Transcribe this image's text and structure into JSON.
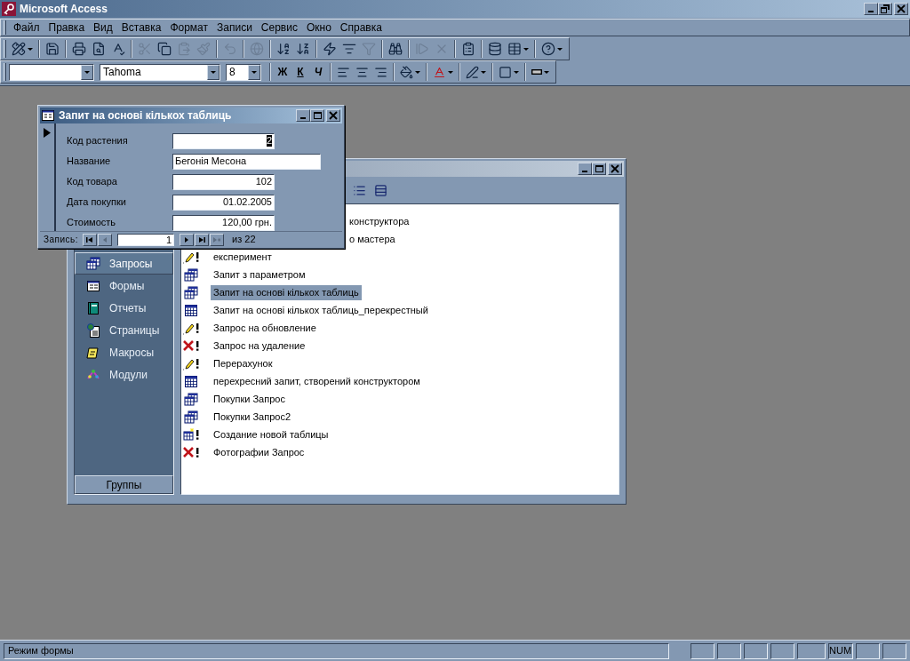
{
  "app": {
    "title": "Microsoft Access"
  },
  "menu": [
    "Файл",
    "Правка",
    "Вид",
    "Вставка",
    "Формат",
    "Записи",
    "Сервис",
    "Окно",
    "Справка"
  ],
  "toolbar": [
    {
      "kind": "design",
      "dropdown": true,
      "disabled": false
    },
    {
      "kind": "separator"
    },
    {
      "kind": "save",
      "dropdown": false,
      "disabled": false
    },
    {
      "kind": "separator"
    },
    {
      "kind": "print",
      "dropdown": false,
      "disabled": false
    },
    {
      "kind": "preview",
      "dropdown": false,
      "disabled": false
    },
    {
      "kind": "spelling",
      "dropdown": false,
      "disabled": false
    },
    {
      "kind": "separator"
    },
    {
      "kind": "cut",
      "dropdown": false,
      "disabled": true
    },
    {
      "kind": "copy",
      "dropdown": false,
      "disabled": false
    },
    {
      "kind": "paste",
      "dropdown": false,
      "disabled": true
    },
    {
      "kind": "painter",
      "dropdown": false,
      "disabled": true
    },
    {
      "kind": "separator"
    },
    {
      "kind": "undo",
      "dropdown": false,
      "disabled": true
    },
    {
      "kind": "separator"
    },
    {
      "kind": "hyperlink",
      "dropdown": false,
      "disabled": true
    },
    {
      "kind": "separator"
    },
    {
      "kind": "sort-ascending",
      "dropdown": false,
      "disabled": false
    },
    {
      "kind": "sort-descending",
      "dropdown": false,
      "disabled": false
    },
    {
      "kind": "separator"
    },
    {
      "kind": "filter-selection",
      "dropdown": false,
      "disabled": false
    },
    {
      "kind": "filter-form",
      "dropdown": false,
      "disabled": false
    },
    {
      "kind": "apply-filter",
      "dropdown": false,
      "disabled": true
    },
    {
      "kind": "separator"
    },
    {
      "kind": "find",
      "dropdown": false,
      "disabled": false
    },
    {
      "kind": "separator"
    },
    {
      "kind": "new-record",
      "dropdown": false,
      "disabled": true
    },
    {
      "kind": "delete-record",
      "dropdown": false,
      "disabled": true
    },
    {
      "kind": "separator"
    },
    {
      "kind": "properties",
      "dropdown": false,
      "disabled": false
    },
    {
      "kind": "separator"
    },
    {
      "kind": "database-window",
      "dropdown": false,
      "disabled": false
    },
    {
      "kind": "new-object",
      "dropdown": true,
      "disabled": false
    },
    {
      "kind": "separator"
    },
    {
      "kind": "help",
      "dropdown": true,
      "disabled": false
    }
  ],
  "formatting_toolbar": [
    {
      "kind": "object-combo"
    },
    {
      "kind": "font-combo",
      "value": "Tahoma"
    },
    {
      "kind": "size-combo",
      "value": "8"
    },
    {
      "kind": "separator"
    },
    {
      "kind": "text",
      "label": "Ж"
    },
    {
      "kind": "text",
      "label": "К"
    },
    {
      "kind": "text",
      "label": "Ч"
    },
    {
      "kind": "separator"
    },
    {
      "kind": "align-left"
    },
    {
      "kind": "align-center"
    },
    {
      "kind": "align-right"
    },
    {
      "kind": "separator"
    },
    {
      "kind": "fill-color"
    },
    {
      "kind": "separator"
    },
    {
      "kind": "font-color"
    },
    {
      "kind": "separator"
    },
    {
      "kind": "line-color"
    },
    {
      "kind": "separator"
    },
    {
      "kind": "effect"
    },
    {
      "kind": "separator"
    },
    {
      "kind": "border-width"
    }
  ],
  "form_window": {
    "title": "Запит на основі кількох таблиць",
    "fields": [
      {
        "label": "Код растения",
        "value": "2",
        "kind": "number",
        "selected": true
      },
      {
        "label": "Название",
        "value": "Бегонія Месона",
        "kind": "text",
        "selected": false
      },
      {
        "label": "Код товара",
        "value": "102",
        "kind": "number",
        "selected": false
      },
      {
        "label": "Дата покупки",
        "value": "01.02.2005",
        "kind": "number",
        "selected": false
      },
      {
        "label": "Стоимость",
        "value": "120,00 грн.",
        "kind": "number",
        "selected": false
      }
    ],
    "navigation": {
      "label": "Запись:",
      "record": "1",
      "total": "из 22",
      "buttons": [
        {
          "kind": "first",
          "disabled": false
        },
        {
          "kind": "previous",
          "disabled": true
        },
        {
          "kind": "next",
          "disabled": false
        },
        {
          "kind": "last",
          "disabled": false
        },
        {
          "kind": "new",
          "disabled": true
        }
      ]
    }
  },
  "database_window": {
    "toolbar": [
      {
        "kind": "list"
      },
      {
        "kind": "details"
      }
    ],
    "objects": [
      {
        "label": "Запросы",
        "kind": "queries",
        "selected": true
      },
      {
        "label": "Формы",
        "kind": "forms",
        "selected": false
      },
      {
        "label": "Отчеты",
        "kind": "reports",
        "selected": false
      },
      {
        "label": "Страницы",
        "kind": "pages",
        "selected": false
      },
      {
        "label": "Макросы",
        "kind": "macros",
        "selected": false
      },
      {
        "label": "Модули",
        "kind": "modules",
        "selected": false
      }
    ],
    "groups_button": "Группы",
    "items": [
      {
        "label": "конструктора",
        "selected": false
      },
      {
        "label": "о мастера",
        "selected": false
      },
      {
        "label": "експеримент",
        "kind": "update",
        "selected": false
      },
      {
        "label": "Запит з параметром",
        "kind": "select",
        "selected": false
      },
      {
        "label": "Запит на основі кількох таблиць",
        "kind": "select",
        "selected": true
      },
      {
        "label": "Запит на основі кількох таблиць_перекрестный",
        "kind": "crosstab",
        "selected": false
      },
      {
        "label": "Запрос на обновление",
        "kind": "update",
        "selected": false
      },
      {
        "label": "Запрос на удаление",
        "kind": "delete",
        "selected": false
      },
      {
        "label": "Перерахунок",
        "kind": "update",
        "selected": false
      },
      {
        "label": "перехресний запит, створений конструктором",
        "kind": "crosstab",
        "selected": false
      },
      {
        "label": "Покупки Запрос",
        "kind": "select",
        "selected": false
      },
      {
        "label": "Покупки Запрос2",
        "kind": "select",
        "selected": false
      },
      {
        "label": "Создание новой таблицы",
        "kind": "maketable",
        "selected": false
      },
      {
        "label": "Фотографии Запрос",
        "kind": "delete",
        "selected": false
      }
    ]
  },
  "status_bar": {
    "text": "Режим формы",
    "panels": [
      {
        "kind": "blank"
      },
      {
        "kind": "blank"
      },
      {
        "kind": "blank"
      },
      {
        "kind": "blank"
      },
      {
        "kind": "blank"
      },
      {
        "kind": "label",
        "label": "NUM"
      },
      {
        "kind": "blank"
      },
      {
        "kind": "blank"
      }
    ]
  }
}
